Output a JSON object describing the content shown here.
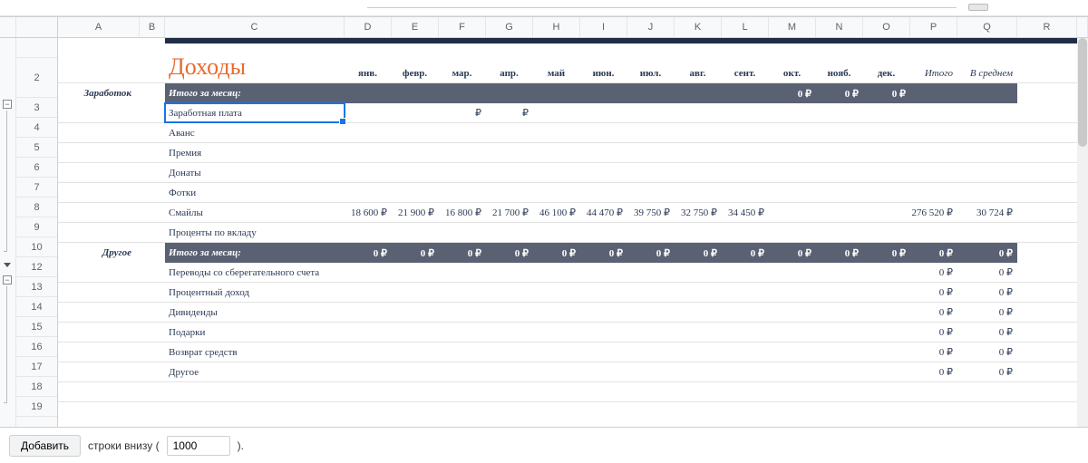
{
  "columns": {
    "letters": [
      "A",
      "B",
      "C",
      "D",
      "E",
      "F",
      "G",
      "H",
      "I",
      "J",
      "K",
      "L",
      "M",
      "N",
      "O",
      "P",
      "Q",
      "R"
    ],
    "widths": [
      90,
      28,
      198,
      52,
      52,
      52,
      52,
      52,
      52,
      52,
      52,
      52,
      52,
      52,
      52,
      52,
      66,
      66,
      40
    ]
  },
  "row_numbers": [
    "",
    "2",
    "3",
    "4",
    "5",
    "6",
    "7",
    "8",
    "9",
    "10",
    "12",
    "13",
    "14",
    "15",
    "16",
    "17",
    "18",
    "19"
  ],
  "header": {
    "title": "Доходы",
    "months": [
      "янв.",
      "февр.",
      "мар.",
      "апр.",
      "май",
      "июн.",
      "июл.",
      "авг.",
      "сент.",
      "окт.",
      "нояб.",
      "дек."
    ],
    "total_label": "Итого",
    "avg_label": "В среднем"
  },
  "sections": [
    {
      "label": "Заработок",
      "subtotal_label": "Итого за месяц:",
      "subtotal_months": [
        "",
        "",
        "",
        "",
        "",
        "",
        "",
        "",
        "",
        "0 ₽",
        "0 ₽",
        "0 ₽"
      ],
      "subtotal_total": "",
      "subtotal_avg": "",
      "items": [
        {
          "name": "Заработная плата",
          "values": [
            "",
            "",
            "₽",
            "₽",
            "",
            "",
            "",
            "",
            "",
            "",
            "",
            ""
          ],
          "total": "",
          "avg": ""
        },
        {
          "name": "Аванс",
          "values": [
            "",
            "",
            "",
            "",
            "",
            "",
            "",
            "",
            "",
            "",
            "",
            ""
          ],
          "total": "",
          "avg": ""
        },
        {
          "name": "Премия",
          "values": [
            "",
            "",
            "",
            "",
            "",
            "",
            "",
            "",
            "",
            "",
            "",
            ""
          ],
          "total": "",
          "avg": ""
        },
        {
          "name": "Донаты",
          "values": [
            "",
            "",
            "",
            "",
            "",
            "",
            "",
            "",
            "",
            "",
            "",
            ""
          ],
          "total": "",
          "avg": ""
        },
        {
          "name": "Фотки",
          "values": [
            "",
            "",
            "",
            "",
            "",
            "",
            "",
            "",
            "",
            "",
            "",
            ""
          ],
          "total": "",
          "avg": ""
        },
        {
          "name": "Смайлы",
          "values": [
            "18 600 ₽",
            "21 900 ₽",
            "16 800 ₽",
            "21 700 ₽",
            "46 100 ₽",
            "44 470 ₽",
            "39 750 ₽",
            "32 750 ₽",
            "34 450 ₽",
            "",
            "",
            ""
          ],
          "total": "276 520 ₽",
          "avg": "30 724 ₽"
        },
        {
          "name": "Проценты по вкладу",
          "values": [
            "",
            "",
            "",
            "",
            "",
            "",
            "",
            "",
            "",
            "",
            "",
            ""
          ],
          "total": "",
          "avg": ""
        }
      ]
    },
    {
      "label": "Другое",
      "subtotal_label": "Итого за месяц:",
      "subtotal_months": [
        "0 ₽",
        "0 ₽",
        "0 ₽",
        "0 ₽",
        "0 ₽",
        "0 ₽",
        "0 ₽",
        "0 ₽",
        "0 ₽",
        "0 ₽",
        "0 ₽",
        "0 ₽"
      ],
      "subtotal_total": "0 ₽",
      "subtotal_avg": "0 ₽",
      "items": [
        {
          "name": "Переводы со сберегательного счета",
          "values": [
            "",
            "",
            "",
            "",
            "",
            "",
            "",
            "",
            "",
            "",
            "",
            ""
          ],
          "total": "0 ₽",
          "avg": "0 ₽"
        },
        {
          "name": "Процентный доход",
          "values": [
            "",
            "",
            "",
            "",
            "",
            "",
            "",
            "",
            "",
            "",
            "",
            ""
          ],
          "total": "0 ₽",
          "avg": "0 ₽"
        },
        {
          "name": "Дивиденды",
          "values": [
            "",
            "",
            "",
            "",
            "",
            "",
            "",
            "",
            "",
            "",
            "",
            ""
          ],
          "total": "0 ₽",
          "avg": "0 ₽"
        },
        {
          "name": "Подарки",
          "values": [
            "",
            "",
            "",
            "",
            "",
            "",
            "",
            "",
            "",
            "",
            "",
            ""
          ],
          "total": "0 ₽",
          "avg": "0 ₽"
        },
        {
          "name": "Возврат средств",
          "values": [
            "",
            "",
            "",
            "",
            "",
            "",
            "",
            "",
            "",
            "",
            "",
            ""
          ],
          "total": "0 ₽",
          "avg": "0 ₽"
        },
        {
          "name": "Другое",
          "values": [
            "",
            "",
            "",
            "",
            "",
            "",
            "",
            "",
            "",
            "",
            "",
            ""
          ],
          "total": "0 ₽",
          "avg": "0 ₽"
        }
      ]
    }
  ],
  "footer": {
    "add_button": "Добавить",
    "rows_below_left": "строки внизу (",
    "rows_below_right": ").",
    "rows_input": "1000"
  },
  "selection": {
    "row": 4,
    "col": "C",
    "value": "Заработная плата"
  },
  "colors": {
    "title": "#e86a2e",
    "navy": "#1f2d47",
    "section": "#5a6172",
    "text": "#2b3a55"
  }
}
